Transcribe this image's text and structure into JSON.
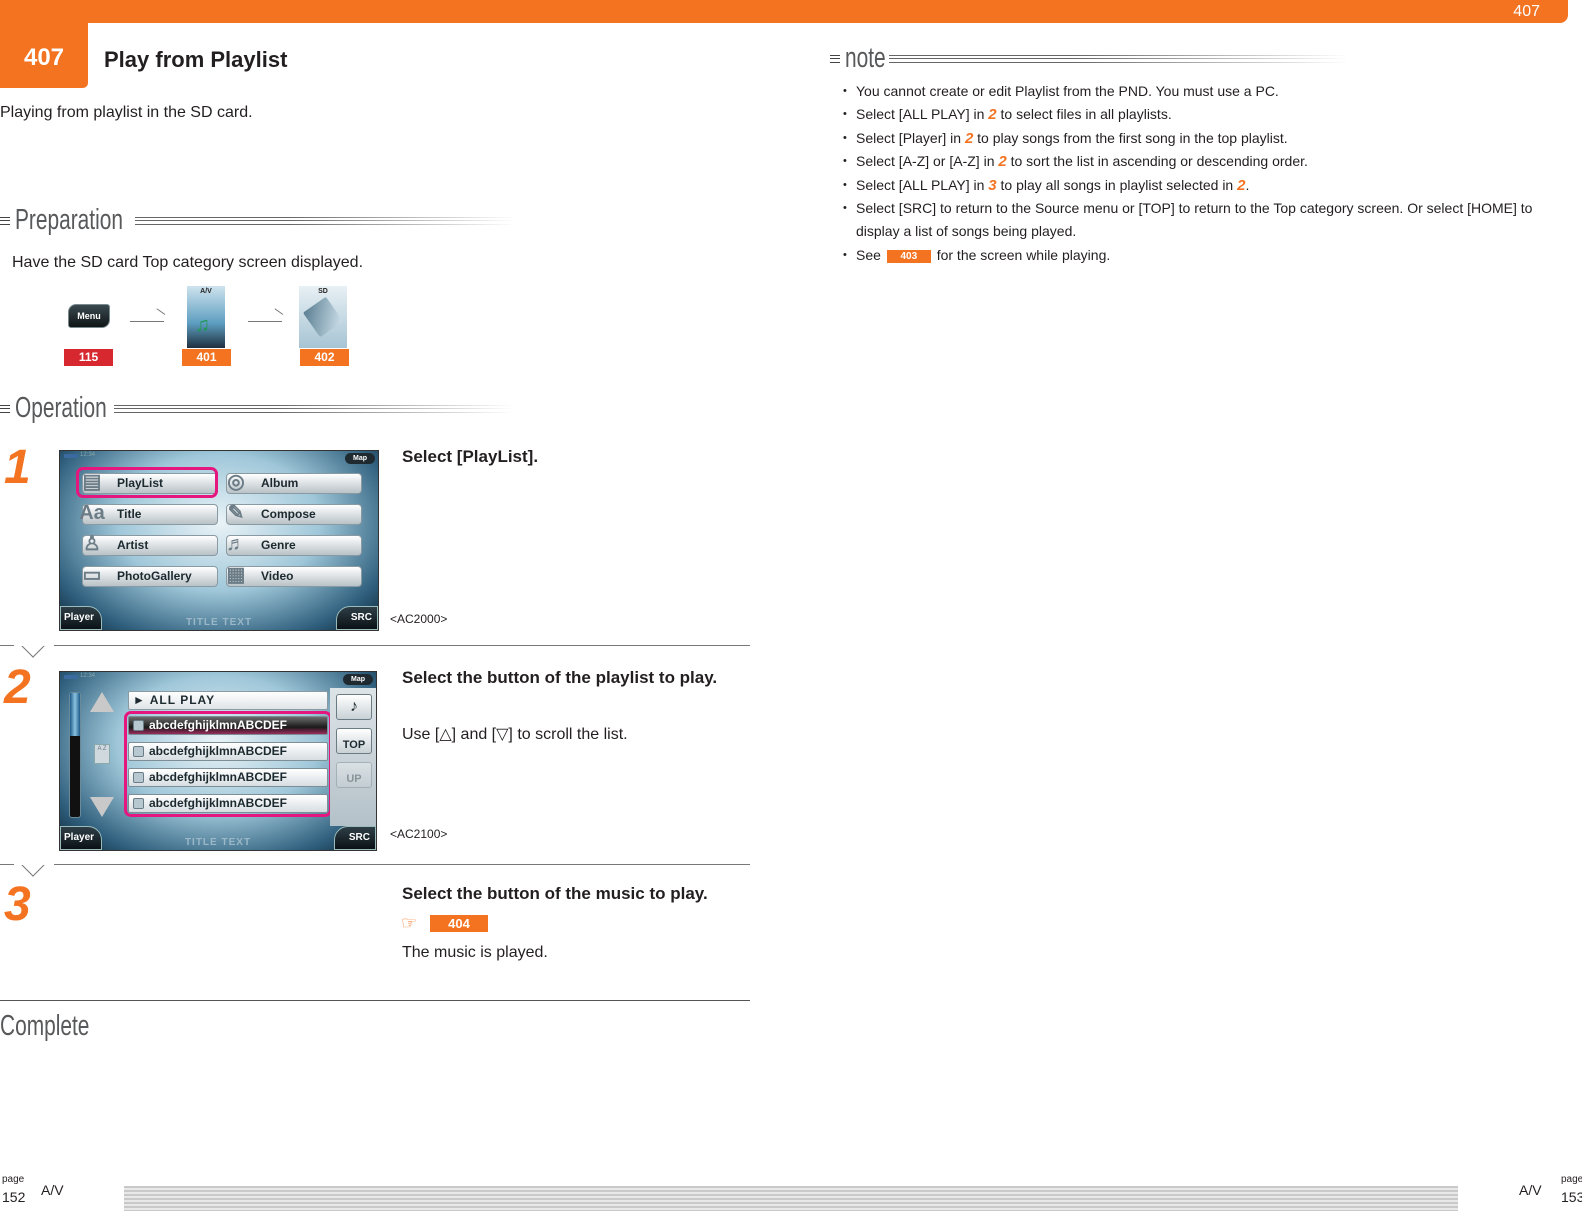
{
  "header": {
    "section_number": "407",
    "top_right_number": "407",
    "title": "Play from Playlist",
    "intro": "Playing from playlist in the SD card.",
    "accent_color": "#f37321"
  },
  "preparation": {
    "heading": "Preparation",
    "text": "Have the SD card Top category screen displayed.",
    "flow": [
      {
        "label": "Menu",
        "ref": "115",
        "ref_color": "#d7282f"
      },
      {
        "label": "A/V",
        "ref": "401",
        "ref_color": "#f37321"
      },
      {
        "label": "SD",
        "ref": "402",
        "ref_color": "#f37321"
      }
    ]
  },
  "operation": {
    "heading": "Operation",
    "steps": [
      {
        "number": "1",
        "title": "Select [PlayList].",
        "screen_code": "<AC2000>",
        "screen": {
          "clock": "12:34",
          "map_label": "Map",
          "player_label": "Player",
          "src_label": "SRC",
          "title_text": "TITLE TEXT",
          "buttons": [
            "PlayList",
            "Album",
            "Title",
            "Compose",
            "Artist",
            "Genre",
            "PhotoGallery",
            "Video"
          ],
          "highlighted": "PlayList"
        }
      },
      {
        "number": "2",
        "title": "Select the button of the playlist to play.",
        "desc": "Use [△] and [▽] to scroll the list.",
        "screen_code": "<AC2100>",
        "screen": {
          "clock": "12:34",
          "map_label": "Map",
          "player_label": "Player",
          "src_label": "SRC",
          "title_text": "TITLE TEXT",
          "all_play": "► ALL PLAY",
          "az_label": "A Z",
          "rows": [
            "abcdefghijklmnABCDEF",
            "abcdefghijklmnABCDEF",
            "abcdefghijklmnABCDEF",
            "abcdefghijklmnABCDEF"
          ],
          "side_buttons": [
            "♪",
            "TOP",
            "UP"
          ],
          "scroll_position": 0.35
        }
      },
      {
        "number": "3",
        "title": "Select the button of the music to play.",
        "ref": "404",
        "desc": "The music is played."
      }
    ],
    "complete": "Complete"
  },
  "note": {
    "heading": "note",
    "items": [
      {
        "parts": [
          "You cannot create or edit Playlist from the PND. You must use a PC."
        ]
      },
      {
        "before": "Select [ALL PLAY] in ",
        "ref": "2",
        "after": " to select files in all playlists."
      },
      {
        "before": "Select [Player] in ",
        "ref": "2",
        "after": " to play songs from the first song in the top playlist."
      },
      {
        "before": "Select [A-Z] or [A-Z] in ",
        "ref": "2",
        "after": " to sort the list in ascending or descending order."
      },
      {
        "before": "Select [ALL PLAY] in ",
        "ref": "3",
        "mid": " to play all songs in playlist selected in ",
        "ref2": "2",
        "after": "."
      },
      {
        "parts": [
          "Select [SRC] to return to the Source menu or [TOP] to return to the Top category screen. Or select [HOME] to display a list of songs being played."
        ]
      },
      {
        "before": "See ",
        "badge": "403",
        "after": " for the screen while playing."
      }
    ]
  },
  "footer": {
    "left": {
      "page_label": "page",
      "page_number": "152",
      "section": "A/V"
    },
    "right": {
      "page_label": "page",
      "page_number": "153",
      "section": "A/V"
    }
  }
}
